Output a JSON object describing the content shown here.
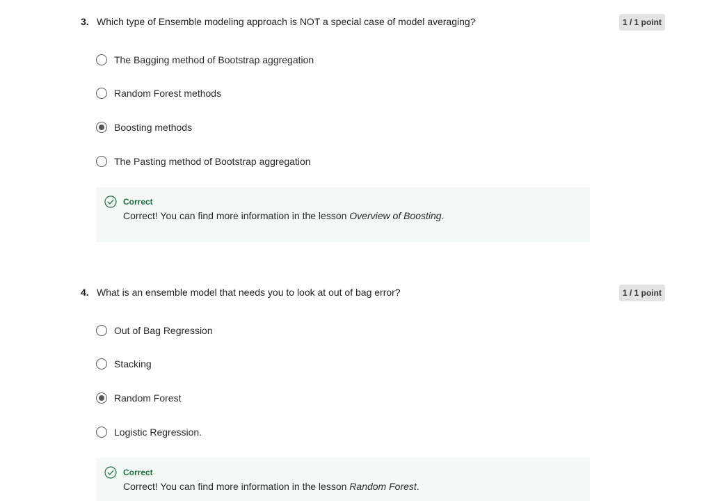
{
  "questions": [
    {
      "number": "3.",
      "text": "Which type of Ensemble modeling approach is NOT a special case of model averaging?",
      "points": "1 / 1 point",
      "options": [
        {
          "label": "The Bagging method of Bootstrap aggregation",
          "selected": false
        },
        {
          "label": "Random Forest methods",
          "selected": false
        },
        {
          "label": "Boosting methods",
          "selected": true
        },
        {
          "label": "The Pasting method of Bootstrap aggregation",
          "selected": false
        }
      ],
      "feedback": {
        "title": "Correct",
        "text": "Correct! You can find more information in the lesson ",
        "lesson": "Overview of Boosting",
        "suffix": "."
      }
    },
    {
      "number": "4.",
      "text": "What is an ensemble model that needs you to look at out of bag error?",
      "points": "1 / 1 point",
      "options": [
        {
          "label": "Out of Bag Regression",
          "selected": false
        },
        {
          "label": "Stacking",
          "selected": false
        },
        {
          "label": "Random Forest",
          "selected": true
        },
        {
          "label": "Logistic Regression.",
          "selected": false
        }
      ],
      "feedback": {
        "title": "Correct",
        "text": "Correct! You can find more information in the lesson ",
        "lesson": "Random Forest",
        "suffix": "."
      }
    }
  ],
  "colors": {
    "correct_green": "#1f6e43",
    "feedback_bg": "#f4f8f6",
    "badge_bg": "#e3e3e3"
  },
  "icons": {
    "radio": "radio-button",
    "feedback": "check-circle-icon"
  }
}
